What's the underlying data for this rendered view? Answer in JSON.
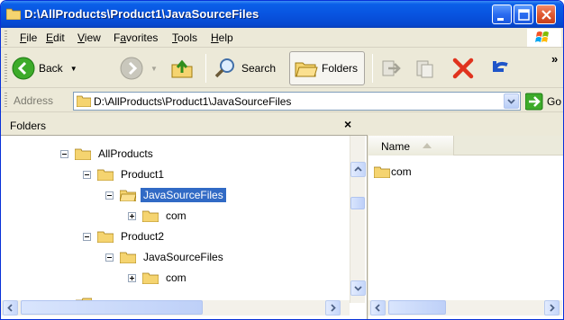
{
  "window": {
    "title": "D:\\AllProducts\\Product1\\JavaSourceFiles"
  },
  "menu": [
    "File",
    "Edit",
    "View",
    "Favorites",
    "Tools",
    "Help"
  ],
  "menu_underline": [
    "F",
    "E",
    "V",
    "a",
    "T",
    "H"
  ],
  "toolbar": {
    "back_label": "Back",
    "search_label": "Search",
    "folders_label": "Folders",
    "overflow": "»"
  },
  "address": {
    "label": "Address",
    "value": "D:\\AllProducts\\Product1\\JavaSourceFiles",
    "go_label": "Go"
  },
  "folders_pane": {
    "header": "Folders",
    "close": "×",
    "tree": [
      {
        "label": "AllProducts",
        "expander": "minus",
        "selected": false
      },
      {
        "label": "Product1",
        "expander": "minus",
        "selected": false
      },
      {
        "label": "JavaSourceFiles",
        "expander": "minus",
        "selected": true
      },
      {
        "label": "com",
        "expander": "plus",
        "selected": false
      },
      {
        "label": "Product2",
        "expander": "minus",
        "selected": false
      },
      {
        "label": "JavaSourceFiles",
        "expander": "minus",
        "selected": false
      },
      {
        "label": "com",
        "expander": "plus",
        "selected": false
      }
    ]
  },
  "file_list": {
    "column_name": "Name",
    "items": [
      "com"
    ]
  },
  "colors": {
    "titlebar": "#0854e0",
    "selection": "#316ac5",
    "folder": "#f5d470"
  }
}
